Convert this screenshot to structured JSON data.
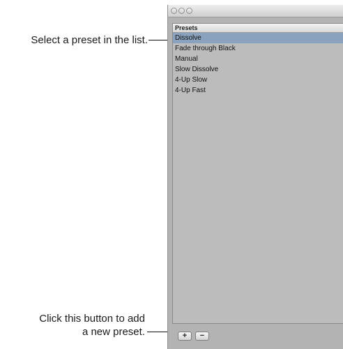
{
  "callouts": {
    "select_preset": "Select a preset in the list.",
    "add_button_line1": "Click this button to add",
    "add_button_line2": "a new preset."
  },
  "window": {
    "list_header": "Presets",
    "presets": [
      {
        "label": "Dissolve",
        "selected": true
      },
      {
        "label": "Fade through Black",
        "selected": false
      },
      {
        "label": "Manual",
        "selected": false
      },
      {
        "label": "Slow Dissolve",
        "selected": false
      },
      {
        "label": "4-Up Slow",
        "selected": false
      },
      {
        "label": "4-Up Fast",
        "selected": false
      }
    ],
    "add_label": "+",
    "remove_label": "−"
  },
  "colors": {
    "selection": "#8aa2bd",
    "panel": "#b3b3b3"
  }
}
